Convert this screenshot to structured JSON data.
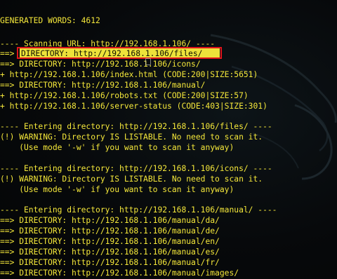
{
  "terminal": {
    "lines": [
      "GENERATED WORDS: 4612",
      "",
      "---- Scanning URL: http://192.168.1.106/ ----",
      "==> DIRECTORY: http://192.168.1.106/files/",
      "==> DIRECTORY: http://192.168.1.106/icons/",
      "+ http://192.168.1.106/index.html (CODE:200|SIZE:5651)",
      "==> DIRECTORY: http://192.168.1.106/manual/",
      "+ http://192.168.1.106/robots.txt (CODE:200|SIZE:57)",
      "+ http://192.168.1.106/server-status (CODE:403|SIZE:301)",
      "",
      "---- Entering directory: http://192.168.1.106/files/ ----",
      "(!) WARNING: Directory IS LISTABLE. No need to scan it.",
      "    (Use mode '-w' if you want to scan it anyway)",
      "",
      "---- Entering directory: http://192.168.1.106/icons/ ----",
      "(!) WARNING: Directory IS LISTABLE. No need to scan it.",
      "    (Use mode '-w' if you want to scan it anyway)",
      "",
      "---- Entering directory: http://192.168.1.106/manual/ ----",
      "==> DIRECTORY: http://192.168.1.106/manual/da/",
      "==> DIRECTORY: http://192.168.1.106/manual/de/",
      "==> DIRECTORY: http://192.168.1.106/manual/en/",
      "==> DIRECTORY: http://192.168.1.106/manual/es/",
      "==> DIRECTORY: http://192.168.1.106/manual/fr/",
      "==> DIRECTORY: http://192.168.1.106/manual/images/"
    ],
    "highlight_text": "DIRECTORY: http://192.168.1.106/files/",
    "text_color": "#f5e83a",
    "highlight_border_color": "#e0141a",
    "background_color": "#050708"
  }
}
